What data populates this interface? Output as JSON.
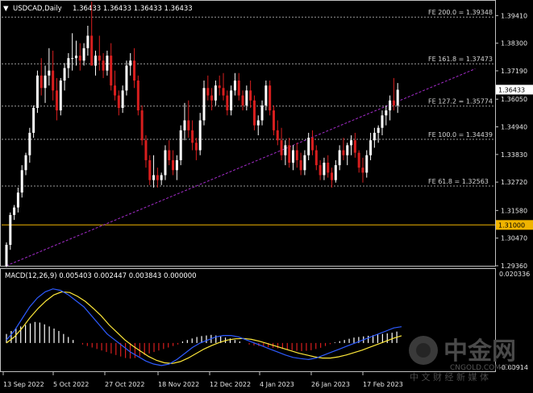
{
  "title": {
    "symbol": "USDCAD,Daily",
    "ohlc": "1.36433 1.36433 1.36433 1.36433"
  },
  "price_axis": {
    "ticks": [
      "1.39410",
      "1.38300",
      "1.37190",
      "1.36050",
      "1.34940",
      "1.33830",
      "1.32720",
      "1.31580",
      "1.30470",
      "1.29360"
    ],
    "current_price": "1.36433",
    "level_price": "1.31000"
  },
  "macd_axis": {
    "label": "MACD(12,26,9) 0.005403 0.002447 0.003843 0.000000",
    "top": "0.020336",
    "bottom": "-0.00914"
  },
  "time_axis": [
    "13 Sep 2022",
    "5 Oct 2022",
    "27 Oct 2022",
    "18 Nov 2022",
    "12 Dec 2022",
    "4 Jan 2023",
    "26 Jan 2023",
    "17 Feb 2023"
  ],
  "fib_levels": [
    {
      "label": "FE 200.0 = 1.39348",
      "price": 1.39348
    },
    {
      "label": "FE 161.8 = 1.37473",
      "price": 1.37473
    },
    {
      "label": "FE 127.2 = 1.35774",
      "price": 1.35774
    },
    {
      "label": "FE 100.0 = 1.34439",
      "price": 1.34439
    },
    {
      "label": "FE 61.8 = 1.32563",
      "price": 1.32563
    }
  ],
  "watermark": {
    "brand": "中金网",
    "url": "CNGOLD.COM.CN",
    "slogan": "中 文 财 经 新 媒 体"
  },
  "colors": {
    "background": "#000000",
    "up_candle": "#ffffff",
    "down_candle": "#d81e1e",
    "level_line": "#f0b400",
    "trendline": "#a52dcc",
    "macd_line": "#2d5bff",
    "signal_line": "#ffe93a",
    "hist_up": "#ffffff",
    "hist_down": "#d81e1e"
  },
  "chart_data": {
    "type": "candlestick",
    "price_range": [
      1.2936,
      1.3997
    ],
    "candles": [
      [
        1.2936,
        1.303,
        1.293,
        1.302
      ],
      [
        1.302,
        1.315,
        1.3,
        1.314
      ],
      [
        1.314,
        1.318,
        1.312,
        1.317
      ],
      [
        1.317,
        1.325,
        1.315,
        1.323
      ],
      [
        1.323,
        1.334,
        1.321,
        1.332
      ],
      [
        1.332,
        1.339,
        1.33,
        1.338
      ],
      [
        1.338,
        1.349,
        1.335,
        1.347
      ],
      [
        1.347,
        1.358,
        1.345,
        1.357
      ],
      [
        1.357,
        1.372,
        1.355,
        1.37
      ],
      [
        1.37,
        1.377,
        1.362,
        1.365
      ],
      [
        1.365,
        1.374,
        1.359,
        1.37
      ],
      [
        1.37,
        1.381,
        1.366,
        1.372
      ],
      [
        1.372,
        1.38,
        1.36,
        1.364
      ],
      [
        1.364,
        1.369,
        1.352,
        1.356
      ],
      [
        1.356,
        1.369,
        1.354,
        1.368
      ],
      [
        1.368,
        1.375,
        1.364,
        1.373
      ],
      [
        1.373,
        1.379,
        1.369,
        1.377
      ],
      [
        1.377,
        1.387,
        1.372,
        1.377
      ],
      [
        1.377,
        1.384,
        1.374,
        1.378
      ],
      [
        1.378,
        1.383,
        1.372,
        1.376
      ],
      [
        1.376,
        1.383,
        1.374,
        1.381
      ],
      [
        1.381,
        1.39,
        1.378,
        1.386
      ],
      [
        1.386,
        1.3997,
        1.382,
        1.374
      ],
      [
        1.374,
        1.38,
        1.37,
        1.378
      ],
      [
        1.378,
        1.386,
        1.372,
        1.376
      ],
      [
        1.376,
        1.379,
        1.369,
        1.372
      ],
      [
        1.372,
        1.38,
        1.37,
        1.378
      ],
      [
        1.378,
        1.383,
        1.364,
        1.366
      ],
      [
        1.366,
        1.372,
        1.36,
        1.362
      ],
      [
        1.362,
        1.364,
        1.354,
        1.357
      ],
      [
        1.357,
        1.366,
        1.355,
        1.364
      ],
      [
        1.364,
        1.376,
        1.362,
        1.374
      ],
      [
        1.374,
        1.379,
        1.37,
        1.376
      ],
      [
        1.376,
        1.381,
        1.365,
        1.368
      ],
      [
        1.368,
        1.37,
        1.354,
        1.356
      ],
      [
        1.356,
        1.358,
        1.342,
        1.344
      ],
      [
        1.344,
        1.346,
        1.333,
        1.336
      ],
      [
        1.336,
        1.338,
        1.326,
        1.328
      ],
      [
        1.328,
        1.338,
        1.325,
        1.33
      ],
      [
        1.33,
        1.333,
        1.325,
        1.328
      ],
      [
        1.328,
        1.331,
        1.326,
        1.33
      ],
      [
        1.33,
        1.342,
        1.328,
        1.34
      ],
      [
        1.34,
        1.344,
        1.334,
        1.336
      ],
      [
        1.336,
        1.34,
        1.33,
        1.332
      ],
      [
        1.332,
        1.338,
        1.328,
        1.336
      ],
      [
        1.336,
        1.35,
        1.334,
        1.348
      ],
      [
        1.348,
        1.359,
        1.344,
        1.352
      ],
      [
        1.352,
        1.36,
        1.345,
        1.348
      ],
      [
        1.348,
        1.352,
        1.34,
        1.343
      ],
      [
        1.343,
        1.345,
        1.336,
        1.34
      ],
      [
        1.34,
        1.355,
        1.338,
        1.352
      ],
      [
        1.352,
        1.368,
        1.35,
        1.365
      ],
      [
        1.365,
        1.37,
        1.36,
        1.362
      ],
      [
        1.362,
        1.365,
        1.356,
        1.36
      ],
      [
        1.36,
        1.368,
        1.358,
        1.366
      ],
      [
        1.366,
        1.37,
        1.362,
        1.365
      ],
      [
        1.365,
        1.371,
        1.36,
        1.362
      ],
      [
        1.362,
        1.364,
        1.354,
        1.356
      ],
      [
        1.356,
        1.366,
        1.354,
        1.364
      ],
      [
        1.364,
        1.371,
        1.362,
        1.368
      ],
      [
        1.368,
        1.371,
        1.36,
        1.362
      ],
      [
        1.362,
        1.364,
        1.356,
        1.358
      ],
      [
        1.358,
        1.366,
        1.356,
        1.364
      ],
      [
        1.364,
        1.368,
        1.357,
        1.36
      ],
      [
        1.36,
        1.362,
        1.348,
        1.35
      ],
      [
        1.35,
        1.354,
        1.346,
        1.352
      ],
      [
        1.352,
        1.36,
        1.35,
        1.358
      ],
      [
        1.358,
        1.368,
        1.356,
        1.366
      ],
      [
        1.366,
        1.368,
        1.354,
        1.356
      ],
      [
        1.356,
        1.358,
        1.346,
        1.348
      ],
      [
        1.348,
        1.352,
        1.342,
        1.344
      ],
      [
        1.344,
        1.349,
        1.336,
        1.338
      ],
      [
        1.338,
        1.344,
        1.334,
        1.342
      ],
      [
        1.342,
        1.345,
        1.333,
        1.335
      ],
      [
        1.335,
        1.342,
        1.332,
        1.34
      ],
      [
        1.34,
        1.343,
        1.333,
        1.336
      ],
      [
        1.336,
        1.339,
        1.33,
        1.332
      ],
      [
        1.332,
        1.34,
        1.33,
        1.338
      ],
      [
        1.338,
        1.347,
        1.336,
        1.345
      ],
      [
        1.345,
        1.348,
        1.338,
        1.34
      ],
      [
        1.34,
        1.342,
        1.332,
        1.334
      ],
      [
        1.334,
        1.336,
        1.328,
        1.33
      ],
      [
        1.33,
        1.337,
        1.328,
        1.335
      ],
      [
        1.335,
        1.338,
        1.329,
        1.331
      ],
      [
        1.331,
        1.333,
        1.325,
        1.328
      ],
      [
        1.328,
        1.336,
        1.327,
        1.334
      ],
      [
        1.334,
        1.342,
        1.332,
        1.34
      ],
      [
        1.34,
        1.345,
        1.336,
        1.338
      ],
      [
        1.338,
        1.343,
        1.334,
        1.342
      ],
      [
        1.342,
        1.346,
        1.338,
        1.344
      ],
      [
        1.344,
        1.347,
        1.337,
        1.339
      ],
      [
        1.339,
        1.34,
        1.331,
        1.333
      ],
      [
        1.333,
        1.337,
        1.327,
        1.331
      ],
      [
        1.331,
        1.34,
        1.329,
        1.338
      ],
      [
        1.338,
        1.347,
        1.336,
        1.344
      ],
      [
        1.344,
        1.349,
        1.341,
        1.347
      ],
      [
        1.347,
        1.35,
        1.343,
        1.349
      ],
      [
        1.349,
        1.356,
        1.346,
        1.354
      ],
      [
        1.354,
        1.358,
        1.35,
        1.356
      ],
      [
        1.356,
        1.362,
        1.352,
        1.36
      ],
      [
        1.36,
        1.369,
        1.356,
        1.358
      ],
      [
        1.358,
        1.367,
        1.355,
        1.3643
      ]
    ],
    "horizontal_levels": [
      1.39348,
      1.37473,
      1.35774,
      1.34439,
      1.32563,
      1.31
    ],
    "trendline": {
      "from_index": 0,
      "to_index": 121,
      "from_price": 1.2936,
      "to_price": 1.3727
    },
    "macd": {
      "range": [
        -0.00914,
        0.020336
      ],
      "histogram": [
        0.003,
        0.004,
        0.0048,
        0.0055,
        0.006,
        0.0065,
        0.007,
        0.0068,
        0.0062,
        0.0055,
        0.0048,
        0.004,
        0.003,
        0.002,
        0.001,
        0.0,
        -0.0005,
        -0.001,
        -0.0015,
        -0.002,
        -0.0025,
        -0.003,
        -0.0035,
        -0.004,
        -0.0045,
        -0.005,
        -0.0052,
        -0.005,
        -0.0045,
        -0.004,
        -0.0035,
        -0.003,
        -0.0025,
        -0.002,
        -0.0015,
        -0.001,
        -0.0005,
        0.0005,
        0.001,
        0.0015,
        0.002,
        0.0023,
        0.0025,
        0.0027,
        0.0025,
        0.0022,
        0.0018,
        0.0015,
        0.001,
        0.0005,
        0.0,
        -0.0005,
        -0.0008,
        -0.001,
        -0.0012,
        -0.0014,
        -0.0016,
        -0.0018,
        -0.002,
        -0.0022,
        -0.0024,
        -0.0026,
        -0.0027,
        -0.0026,
        -0.0024,
        -0.002,
        -0.0016,
        -0.001,
        -0.0004,
        0.0002,
        0.0006,
        0.001,
        0.0014,
        0.0018,
        0.002,
        0.0022,
        0.0024,
        0.0026,
        0.0028,
        0.003,
        0.0032,
        0.0034,
        0.0038
      ],
      "macd_line": [
        0.001,
        0.004,
        0.008,
        0.012,
        0.015,
        0.017,
        0.018,
        0.0175,
        0.016,
        0.014,
        0.012,
        0.009,
        0.006,
        0.003,
        0.001,
        -0.001,
        -0.003,
        -0.0045,
        -0.006,
        -0.007,
        -0.0075,
        -0.007,
        -0.0055,
        -0.0035,
        -0.0015,
        0.0,
        0.001,
        0.002,
        0.0025,
        0.0025,
        0.002,
        0.001,
        0.0,
        -0.001,
        -0.002,
        -0.003,
        -0.004,
        -0.0048,
        -0.0052,
        -0.0055,
        -0.005,
        -0.004,
        -0.003,
        -0.002,
        -0.001,
        0.0,
        0.001,
        0.002,
        0.003,
        0.004,
        0.005,
        0.0054
      ],
      "signal_line": [
        0.0,
        0.002,
        0.005,
        0.0085,
        0.0115,
        0.014,
        0.016,
        0.017,
        0.0168,
        0.0155,
        0.0138,
        0.0115,
        0.009,
        0.006,
        0.0035,
        0.001,
        -0.001,
        -0.0028,
        -0.0045,
        -0.0058,
        -0.0066,
        -0.0068,
        -0.0062,
        -0.005,
        -0.0035,
        -0.002,
        -0.0008,
        0.0002,
        0.001,
        0.0014,
        0.0015,
        0.0012,
        0.0006,
        -0.0002,
        -0.001,
        -0.0018,
        -0.0026,
        -0.0034,
        -0.004,
        -0.0046,
        -0.005,
        -0.005,
        -0.0046,
        -0.004,
        -0.0032,
        -0.0024,
        -0.0014,
        -0.0004,
        0.0006,
        0.0016,
        0.0024
      ]
    }
  }
}
